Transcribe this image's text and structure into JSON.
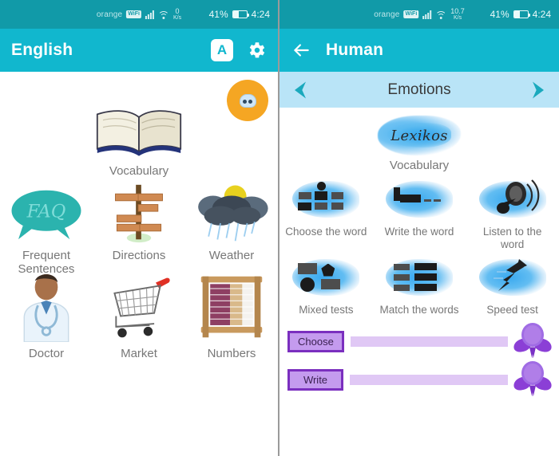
{
  "left": {
    "statusbar": {
      "carrier": "orange",
      "wifi_badge": "WiFi",
      "rate_value": "0",
      "rate_unit": "K/s",
      "battery": "41%",
      "time": "4:24"
    },
    "appbar": {
      "title": "English",
      "font_button": "A",
      "settings_icon": "gear-icon"
    },
    "mascot": {
      "name": "cloud-mascot"
    },
    "hero": {
      "label": "Vocabulary",
      "icon": "open-book-icon"
    },
    "tiles": [
      {
        "label": "Frequent\nSentences",
        "icon": "faq-speech-bubble-icon"
      },
      {
        "label": "Directions",
        "icon": "signpost-icon"
      },
      {
        "label": "Weather",
        "icon": "rain-cloud-sun-icon"
      },
      {
        "label": "Doctor",
        "icon": "doctor-icon"
      },
      {
        "label": "Market",
        "icon": "shopping-cart-icon"
      },
      {
        "label": "Numbers",
        "icon": "abacus-icon"
      }
    ]
  },
  "right": {
    "statusbar": {
      "carrier": "orange",
      "wifi_badge": "WiFi",
      "rate_value": "10.7",
      "rate_unit": "K/s",
      "battery": "41%",
      "time": "4:24"
    },
    "appbar": {
      "title": "Human",
      "back_icon": "back-arrow-icon"
    },
    "subbar": {
      "label": "Emotions",
      "prev_icon": "chevron-left-icon",
      "next_icon": "chevron-right-icon"
    },
    "logo": {
      "script": "Lexikos",
      "label": "Vocabulary"
    },
    "exercises": [
      {
        "label": "Choose the word",
        "icon": "grid-blocks-icon"
      },
      {
        "label": "Write the word",
        "icon": "write-line-icon"
      },
      {
        "label": "Listen to the\nword",
        "icon": "speaker-icon"
      },
      {
        "label": "Mixed tests",
        "icon": "shapes-icon"
      },
      {
        "label": "Match the words",
        "icon": "match-rows-icon"
      },
      {
        "label": "Speed test",
        "icon": "lightning-arrow-icon"
      }
    ],
    "progress": [
      {
        "label": "Choose",
        "value": 100,
        "badge": "medal-icon"
      },
      {
        "label": "Write",
        "value": 100,
        "badge": "medal-icon"
      }
    ]
  },
  "colors": {
    "status_bar": "#119aa8",
    "app_bar": "#11b7ce",
    "sub_bar": "#b9e4f7",
    "accent_teal": "#1aa9bd",
    "mascot_orange": "#f5a623",
    "splash_blue": "#3aa9ef",
    "progress_purple": "#7b2fbf",
    "progress_fill": "#c49bee",
    "caption_gray": "#777777"
  }
}
